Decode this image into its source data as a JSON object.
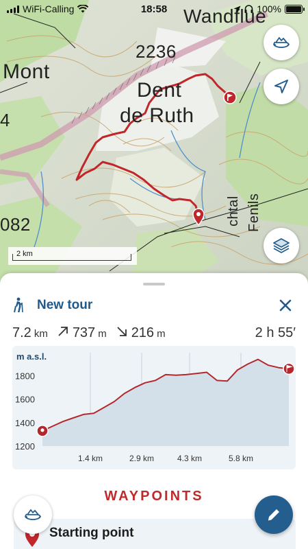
{
  "status_bar": {
    "carrier": "WiFi-Calling",
    "time": "18:58",
    "battery": "100%"
  },
  "map": {
    "labels": {
      "top_peak": "Wandflue",
      "peak_elevation": "2236",
      "mont": "Mont",
      "dent": "Dent",
      "de_ruth": "de Ruth",
      "edge_left_top": "4",
      "edge_left_bottom": "082",
      "valley": "chtal",
      "fenils": "Fenils"
    },
    "scale_label": "2 km",
    "buttons": {
      "rotate": "map-rotate",
      "locate": "navigation-arrow",
      "layers": "layers"
    },
    "route_color": "#c0262a"
  },
  "tour": {
    "title": "New tour",
    "close_icon": "close-icon",
    "activity_icon": "hiking-icon",
    "accent_color": "#1f5a8a"
  },
  "stats": {
    "distance_value": "7.2",
    "distance_unit": "km",
    "ascent_value": "737",
    "ascent_unit": "m",
    "descent_value": "216",
    "descent_unit": "m",
    "duration": "2 h 55′"
  },
  "chart_data": {
    "type": "area",
    "title": "",
    "ylabel": "m a.s.l.",
    "xlabel": "",
    "x_unit": "km",
    "ylim": [
      1200,
      1950
    ],
    "xlim": [
      0,
      7.2
    ],
    "y_ticks": [
      1200,
      1400,
      1600,
      1800
    ],
    "y_tick_labels": [
      "1200",
      "1400",
      "1600",
      "1800"
    ],
    "x_ticks": [
      1.4,
      2.9,
      4.3,
      5.8
    ],
    "x_tick_labels": [
      "1.4 km",
      "2.9 km",
      "4.3 km",
      "5.8 km"
    ],
    "x": [
      0,
      0.3,
      0.6,
      0.9,
      1.2,
      1.5,
      1.8,
      2.1,
      2.4,
      2.7,
      3.0,
      3.3,
      3.6,
      3.9,
      4.2,
      4.5,
      4.8,
      5.1,
      5.4,
      5.7,
      6.0,
      6.3,
      6.6,
      6.9,
      7.2
    ],
    "values": [
      1330,
      1370,
      1410,
      1440,
      1470,
      1480,
      1530,
      1580,
      1650,
      1700,
      1740,
      1760,
      1810,
      1805,
      1810,
      1820,
      1830,
      1760,
      1755,
      1850,
      1900,
      1940,
      1890,
      1870,
      1860
    ],
    "grid": "vertical",
    "line_color": "#b3282d",
    "fill_color": "#d3e0ea",
    "start_marker": "start-pin",
    "end_marker": "finish-flag"
  },
  "waypoints": {
    "section_title": "WAYPOINTS",
    "items": [
      {
        "name": "Starting point",
        "meta": ""
      }
    ]
  },
  "fab": {
    "left_icon": "map-rotate-icon",
    "right_icon": "edit-pencil-icon",
    "right_color": "#245e8e"
  }
}
